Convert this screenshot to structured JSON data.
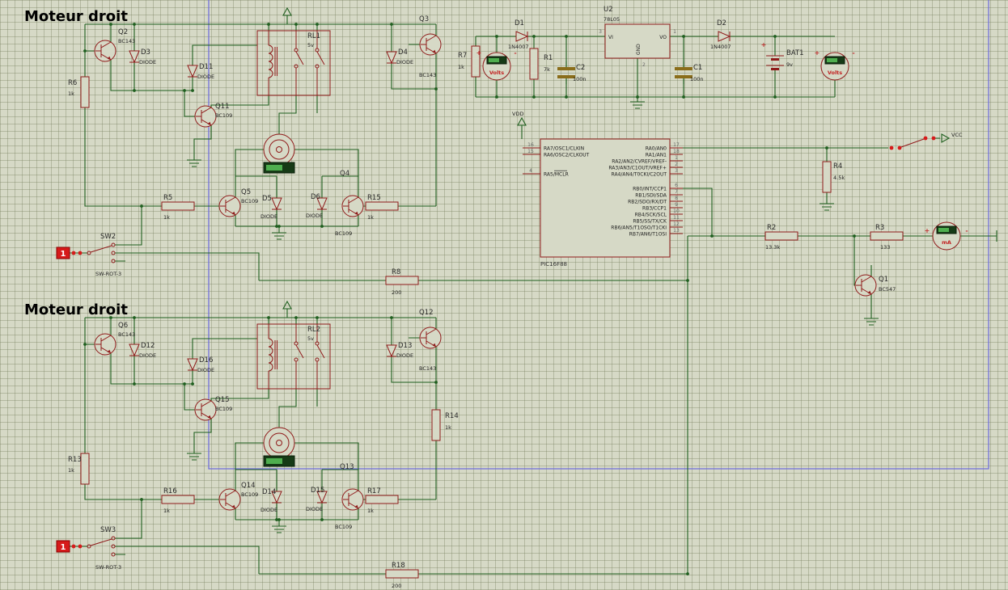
{
  "titles": {
    "top": "Moteur droit",
    "bottom": "Moteur droit"
  },
  "colors": {
    "background": "#d6d9c6",
    "wire_green": "#1f5f1f",
    "component_red": "#8f1a1a",
    "display_green": "#163a16",
    "segment_green": "#4fae4f",
    "probe_red": "#d61a1a",
    "selection_blue": "#6b6bdd"
  },
  "top_block": {
    "q2": {
      "ref": "Q2",
      "val": "BC143"
    },
    "d3": {
      "ref": "D3",
      "val": "DIODE"
    },
    "r6": {
      "ref": "R6",
      "val": "1k"
    },
    "d11": {
      "ref": "D11",
      "val": "DIODE"
    },
    "q11": {
      "ref": "Q11",
      "val": "BC109"
    },
    "rl1": {
      "ref": "RL1",
      "val": "5v"
    },
    "q3": {
      "ref": "Q3",
      "val": "BC143"
    },
    "d4": {
      "ref": "D4",
      "val": "DIODE"
    },
    "q4": {
      "ref": "Q4",
      "val": "BC109"
    },
    "q5": {
      "ref": "Q5",
      "val": "BC109"
    },
    "d5": {
      "ref": "D5",
      "val": "DIODE"
    },
    "d6": {
      "ref": "D6",
      "val": "DIODE"
    },
    "r5": {
      "ref": "R5",
      "val": "1k"
    },
    "r15": {
      "ref": "R15",
      "val": "1k"
    },
    "r8": {
      "ref": "R8",
      "val": "200"
    },
    "sw2": {
      "ref": "SW2",
      "val": "SW-ROT-3"
    },
    "probe": "1"
  },
  "bottom_block": {
    "q6": {
      "ref": "Q6",
      "val": "BC143"
    },
    "d12": {
      "ref": "D12",
      "val": "DIODE"
    },
    "r13": {
      "ref": "R13",
      "val": "1k"
    },
    "d16": {
      "ref": "D16",
      "val": "DIODE"
    },
    "q15": {
      "ref": "Q15",
      "val": "BC109"
    },
    "rl2": {
      "ref": "RL2",
      "val": "5v"
    },
    "q12": {
      "ref": "Q12",
      "val": "BC143"
    },
    "d13": {
      "ref": "D13",
      "val": "DIODE"
    },
    "q13": {
      "ref": "Q13",
      "val": "BC109"
    },
    "q14": {
      "ref": "Q14",
      "val": "BC109"
    },
    "d14": {
      "ref": "D14",
      "val": "DIODE"
    },
    "d15": {
      "ref": "D15",
      "val": "DIODE"
    },
    "r16": {
      "ref": "R16",
      "val": "1k"
    },
    "r17": {
      "ref": "R17",
      "val": "1k"
    },
    "r14": {
      "ref": "R14",
      "val": "1k"
    },
    "r18": {
      "ref": "R18",
      "val": "200"
    },
    "sw3": {
      "ref": "SW3",
      "val": "SW-ROT-3"
    },
    "probe": "1"
  },
  "power": {
    "d1": {
      "ref": "D1",
      "val": "1N4007"
    },
    "r7": {
      "ref": "R7",
      "val": "1k"
    },
    "voltmeter1": {
      "label": "Volts",
      "plus": "+",
      "minus": "-"
    },
    "r1": {
      "ref": "R1",
      "val": "7k"
    },
    "c2": {
      "ref": "C2",
      "val": "100n"
    },
    "u2": {
      "ref": "U2",
      "val": "78L05",
      "vi": "VI",
      "vo": "VO",
      "gnd": "GND",
      "pin_vi": "3",
      "pin_vo": "1",
      "pin_gnd": "2"
    },
    "c1": {
      "ref": "C1",
      "val": "100n"
    },
    "d2": {
      "ref": "D2",
      "val": "1N4007"
    },
    "bat1": {
      "ref": "BAT1",
      "val": "9v",
      "plus": "+"
    },
    "voltmeter2": {
      "label": "Volts",
      "plus": "+",
      "minus": "-"
    },
    "vdd_label": "VDD"
  },
  "mcu": {
    "part": "PIC16F88",
    "left_pins": [
      {
        "num": "16",
        "label": "RA7/OSC1/CLKIN"
      },
      {
        "num": "15",
        "label": "RA6/OSC2/CLKOUT"
      },
      {
        "num": "4",
        "label": "RA5/MCLR"
      }
    ],
    "right_pins": [
      {
        "num": "17",
        "label": "RA0/AN0"
      },
      {
        "num": "18",
        "label": "RA1/AN1"
      },
      {
        "num": "1",
        "label": "RA2/AN2/CVREF/VREF-"
      },
      {
        "num": "2",
        "label": "RA3/AN3/C1OUT/VREF+"
      },
      {
        "num": "3",
        "label": "RA4/AN4/T0CKI/C2OUT"
      },
      {
        "num": "6",
        "label": "RB0/INT/CCP1"
      },
      {
        "num": "7",
        "label": "RB1/SDI/SDA"
      },
      {
        "num": "8",
        "label": "RB2/SDO/RX/DT"
      },
      {
        "num": "9",
        "label": "RB3/CCP1"
      },
      {
        "num": "10",
        "label": "RB4/SCK/SCL"
      },
      {
        "num": "11",
        "label": "RB5/SS/TX/CK"
      },
      {
        "num": "12",
        "label": "RB6/AN5/T1OSO/T1CKI"
      },
      {
        "num": "13",
        "label": "RB7/AN6/T1OSI"
      }
    ]
  },
  "right_side": {
    "vcc_label": "VCC",
    "r4": {
      "ref": "R4",
      "val": "4.5k"
    },
    "r2": {
      "ref": "R2",
      "val": "13.3k"
    },
    "r3": {
      "ref": "R3",
      "val": "133"
    },
    "ammeter": {
      "label": "mA",
      "plus": "+",
      "minus": "-"
    },
    "q1": {
      "ref": "Q1",
      "val": "BC547"
    }
  }
}
